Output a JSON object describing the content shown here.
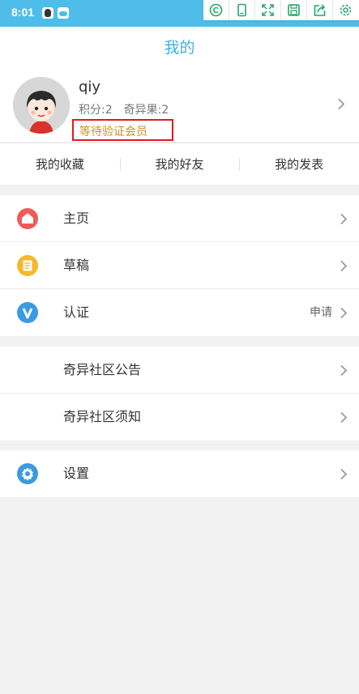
{
  "status_bar": {
    "time": "8:01",
    "background": "#4fbde9",
    "toolbar_icons": [
      "copyright-icon",
      "phone-icon",
      "expand-icon",
      "save-icon",
      "share-icon",
      "settings-gear-icon"
    ]
  },
  "header": {
    "title": "我的",
    "title_color": "#3db2dd"
  },
  "profile": {
    "username": "qiy",
    "points": "积分:2",
    "fruits": "奇异果:2",
    "badge": "等待验证会员",
    "badge_text_color": "#c6922c",
    "badge_border_color": "#e11a1a"
  },
  "tabs": [
    {
      "label": "我的收藏"
    },
    {
      "label": "我的好友"
    },
    {
      "label": "我的发表"
    }
  ],
  "menu": {
    "main": [
      {
        "label": "主页",
        "icon": "home-icon",
        "icon_color": "#ef5a5a",
        "extra": ""
      },
      {
        "label": "草稿",
        "icon": "draft-icon",
        "icon_color": "#f3b82b",
        "extra": ""
      },
      {
        "label": "认证",
        "icon": "verify-icon",
        "icon_color": "#3a9be0",
        "extra": "申请"
      }
    ],
    "community": [
      {
        "label": "奇异社区公告"
      },
      {
        "label": "奇异社区须知"
      }
    ],
    "settings": [
      {
        "label": "设置",
        "icon": "settings-icon",
        "icon_color": "#3a9be0"
      }
    ]
  }
}
